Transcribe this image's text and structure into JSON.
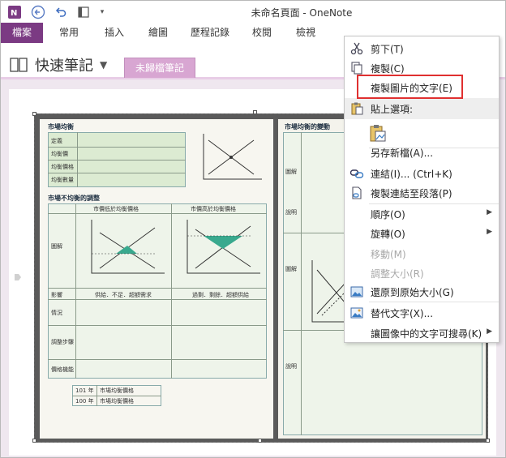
{
  "title_bar": {
    "title": "未命名頁面 - OneNote"
  },
  "ribbon": {
    "tabs": [
      "檔案",
      "常用",
      "插入",
      "繪圖",
      "歷程記錄",
      "校閱",
      "檢視"
    ]
  },
  "notebook": {
    "name": "快速筆記",
    "section": "未歸檔筆記"
  },
  "context_menu": {
    "cut": "剪下(T)",
    "copy": "複製(C)",
    "copy_text_from_picture": "複製圖片的文字(E)",
    "paste_options": "貼上選項:",
    "save_as": "另存新檔(A)...",
    "link": "連結(I)...  (Ctrl+K)",
    "copy_link_to_paragraph": "複製連結至段落(P)",
    "order": "順序(O)",
    "rotate": "旋轉(O)",
    "move": "移動(M)",
    "resize": "調整大小(R)",
    "restore_size": "還原到原始大小(G)",
    "alt_text": "替代文字(X)...",
    "make_searchable": "讓圖像中的文字可搜尋(K)"
  },
  "scan": {
    "left": {
      "heading_1": "市場均衡",
      "rows": [
        "定義",
        "均衡價",
        "均衡價格",
        "均衡數量"
      ],
      "heading_2": "市場不均衡的調整",
      "col_a": "市價低於均衡價格",
      "col_b": "市價高於均衡價格",
      "row_labels": [
        "圖解",
        "影響",
        "情況",
        "調整步驟",
        "價格機能"
      ],
      "impact_a": "供給．不足．超額需求",
      "impact_b": "過剩．剩餘．超額供給",
      "years": [
        "101 年",
        "100 年"
      ],
      "year_notes": [
        "市場均衡價格",
        "市場均衡價格"
      ],
      "axis_y": "價格",
      "axis_x": "數量"
    },
    "right": {
      "heading": "市場均衡的變動",
      "labels": [
        "圖解",
        "說明"
      ]
    }
  }
}
